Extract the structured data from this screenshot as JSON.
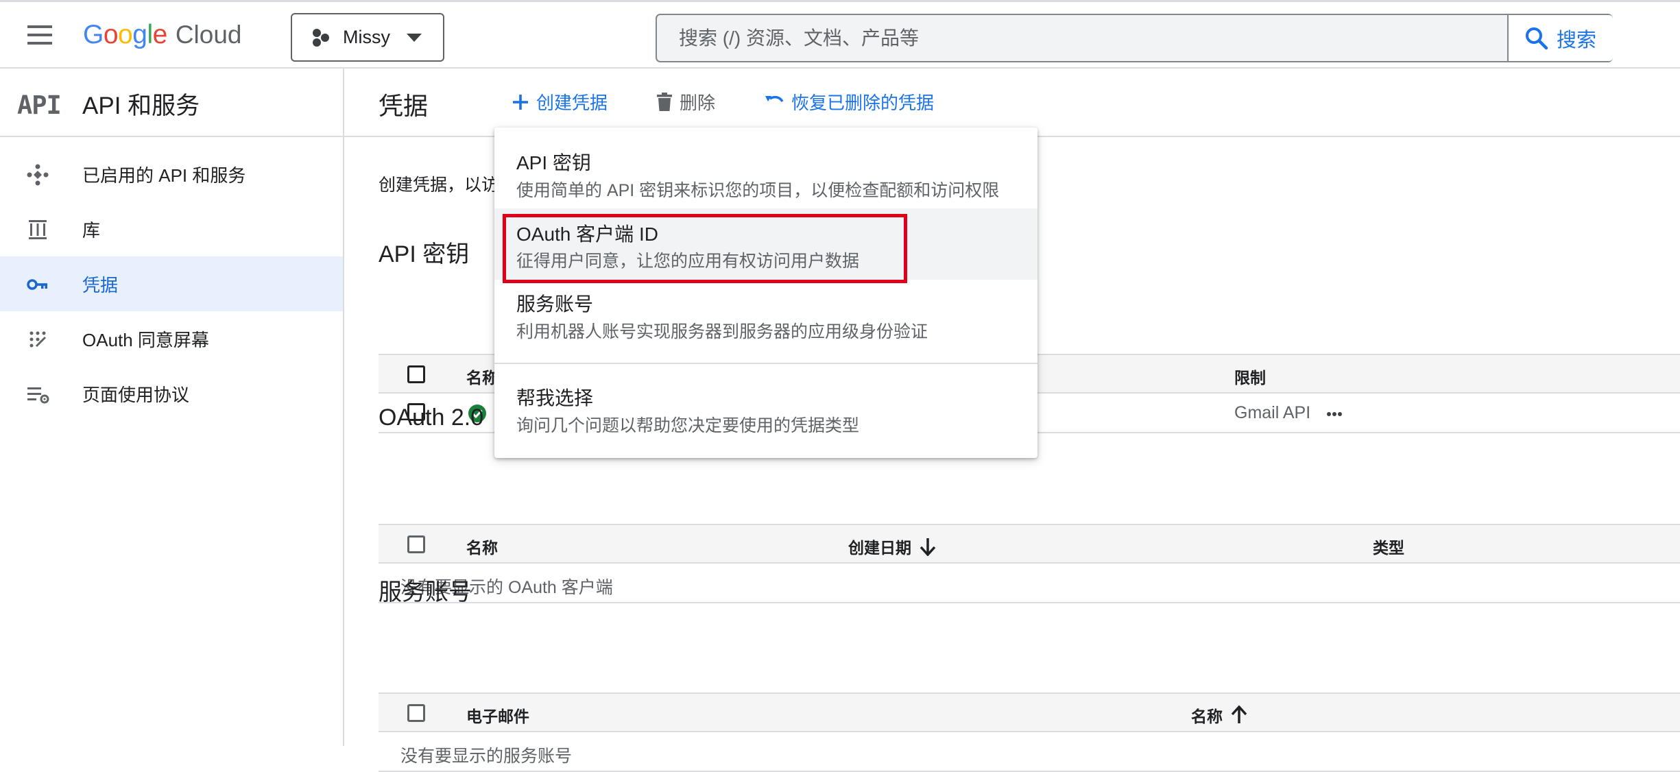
{
  "topbar": {
    "logo_google": [
      "G",
      "o",
      "o",
      "g",
      "l",
      "e"
    ],
    "logo_colors": [
      "#4285f4",
      "#ea4335",
      "#fbbc04",
      "#4285f4",
      "#34a853",
      "#ea4335"
    ],
    "logo_cloud": "Cloud",
    "project_name": "Missy",
    "search_placeholder": "搜索 (/) 资源、文档、产品等",
    "search_button": "搜索"
  },
  "sidebar": {
    "logo": "API",
    "title": "API 和服务",
    "items": [
      {
        "label": "已启用的 API 和服务",
        "icon": "diamond-dots-icon"
      },
      {
        "label": "库",
        "icon": "library-icon"
      },
      {
        "label": "凭据",
        "icon": "key-icon",
        "active": true
      },
      {
        "label": "OAuth 同意屏幕",
        "icon": "consent-dots-icon"
      },
      {
        "label": "页面使用协议",
        "icon": "list-settings-icon"
      }
    ]
  },
  "main": {
    "title": "凭据",
    "actions": {
      "create": "创建凭据",
      "delete": "删除",
      "restore": "恢复已删除的凭据"
    },
    "description": "创建凭据，以访",
    "api_keys": {
      "title": "API 密钥",
      "columns": [
        "名称",
        "限制"
      ],
      "rows": [
        {
          "name": "",
          "restriction": "Gmail API",
          "status": "check-icon"
        }
      ]
    },
    "oauth": {
      "title": "OAuth 2.0",
      "columns": [
        "名称",
        "创建日期",
        "类型"
      ],
      "empty": "没有要显示的 OAuth 客户端"
    },
    "service_accounts": {
      "title": "服务账号",
      "columns": [
        "电子邮件",
        "名称"
      ],
      "empty": "没有要显示的服务账号"
    }
  },
  "dropdown": {
    "items": [
      {
        "title": "API 密钥",
        "subtitle": "使用简单的 API 密钥来标识您的项目，以便检查配额和访问权限"
      },
      {
        "title": "OAuth 客户端 ID",
        "subtitle": "征得用户同意，让您的应用有权访问用户数据"
      },
      {
        "title": "服务账号",
        "subtitle": "利用机器人账号实现服务器到服务器的应用级身份验证"
      },
      {
        "title": "帮我选择",
        "subtitle": "询问几个问题以帮助您决定要使用的凭据类型"
      }
    ],
    "highlight_color": "#e1001a"
  },
  "colors": {
    "accent": "#1a73e8",
    "active_bg": "#e8f0fe",
    "success": "#188038"
  }
}
